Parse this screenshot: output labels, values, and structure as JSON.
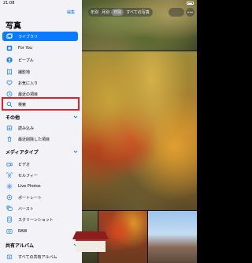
{
  "status_bar": {
    "time": "21:08"
  },
  "sidebar": {
    "edit_label": "編集",
    "title": "写真",
    "items": [
      {
        "label": "ライブラリ",
        "icon": "photo-library-icon",
        "selected": true
      },
      {
        "label": "For You",
        "icon": "for-you-icon",
        "selected": false
      },
      {
        "label": "ピープル",
        "icon": "people-icon",
        "selected": false
      },
      {
        "label": "撮影地",
        "icon": "map-pin-icon",
        "selected": false
      },
      {
        "label": "お気に入り",
        "icon": "heart-icon",
        "selected": false
      },
      {
        "label": "最近の項目",
        "icon": "recents-icon",
        "selected": false
      },
      {
        "label": "検索",
        "icon": "search-icon",
        "selected": false
      }
    ],
    "sections": [
      {
        "title": "その他",
        "items": [
          {
            "label": "読み込み",
            "icon": "import-icon"
          },
          {
            "label": "最近削除した項目",
            "icon": "trash-icon"
          }
        ]
      },
      {
        "title": "メディアタイプ",
        "items": [
          {
            "label": "ビデオ",
            "icon": "video-icon"
          },
          {
            "label": "セルフィー",
            "icon": "selfie-icon"
          },
          {
            "label": "Live Photos",
            "icon": "live-photo-icon"
          },
          {
            "label": "ポートレート",
            "icon": "portrait-icon"
          },
          {
            "label": "バースト",
            "icon": "burst-icon"
          },
          {
            "label": "スクリーンショット",
            "icon": "screenshot-icon"
          },
          {
            "label": "RAW",
            "icon": "raw-icon"
          }
        ]
      },
      {
        "title": "共有アルバム",
        "items": [
          {
            "label": "すべての共有アルバム",
            "icon": "shared-album-icon"
          }
        ]
      }
    ]
  },
  "toolbar": {
    "segments": [
      "年別",
      "月別",
      "日別",
      "すべての写真"
    ],
    "selected_segment": "日別"
  },
  "colors": {
    "accent": "#0a7aff",
    "highlight": "#e0202a",
    "sidebar_bg": "#f2f2f7"
  }
}
